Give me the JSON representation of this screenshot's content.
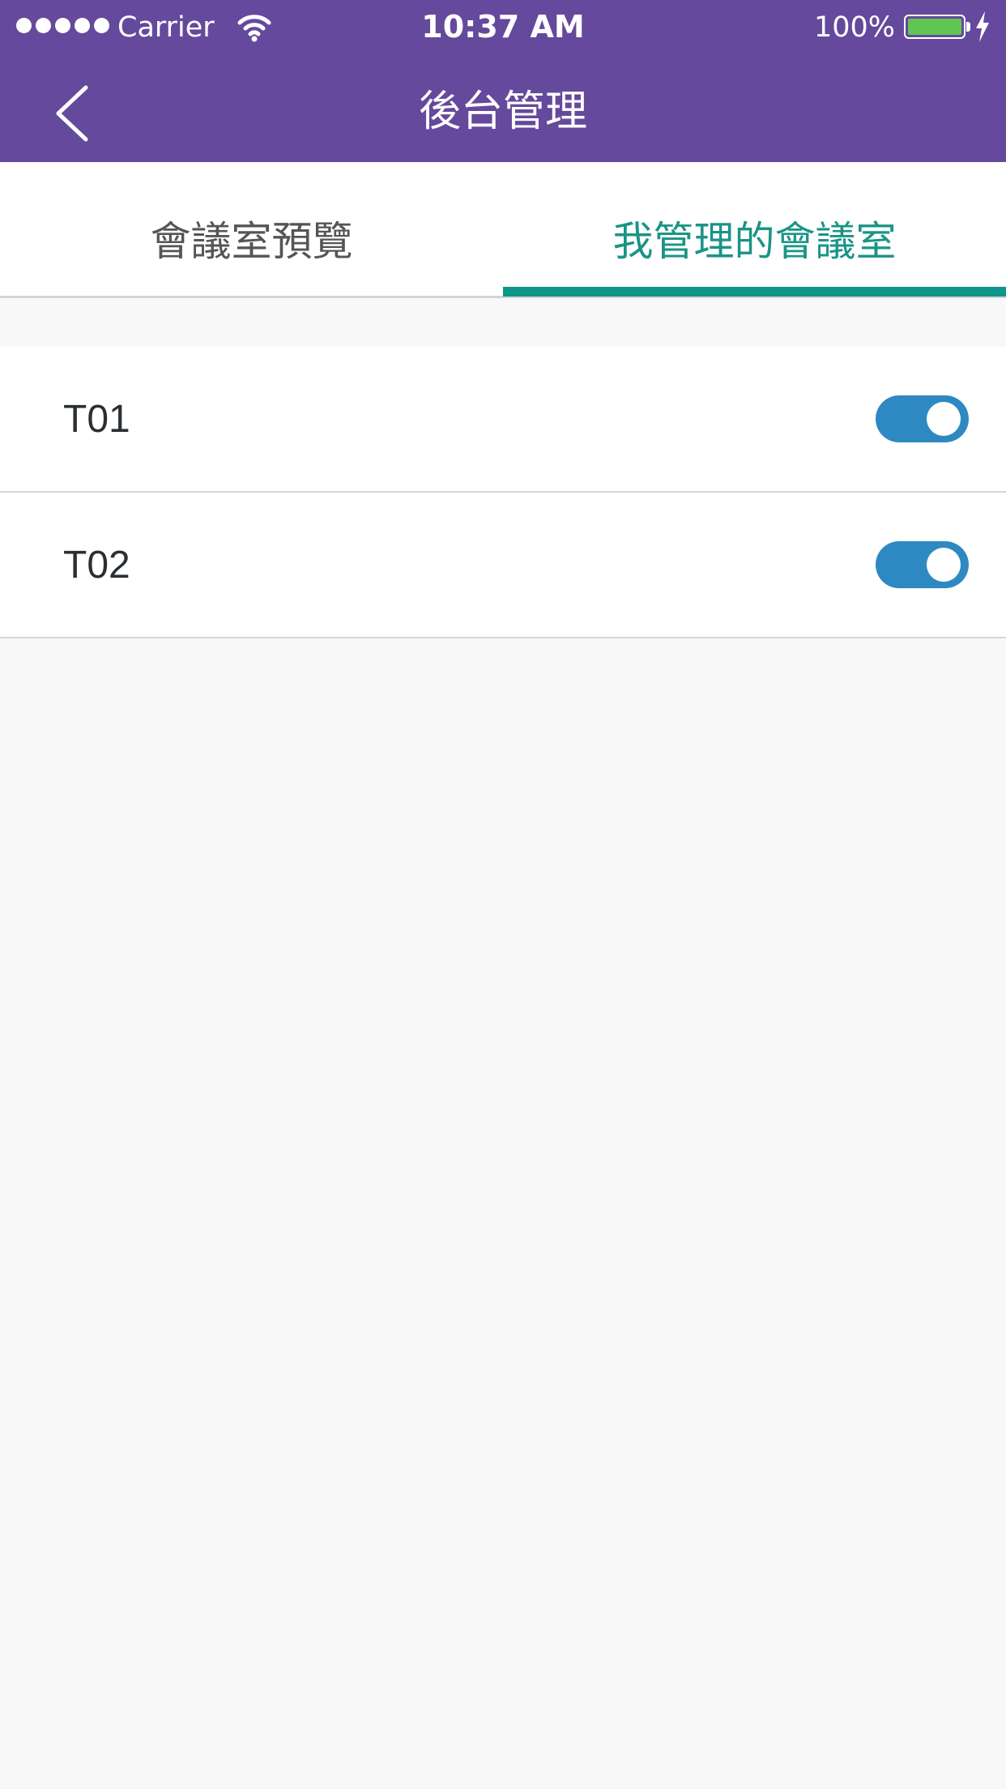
{
  "status_bar": {
    "carrier": "Carrier",
    "time": "10:37 AM",
    "battery_percent": "100%",
    "battery_level": 1.0,
    "signal_bars": 5,
    "battery_fill_color": "#61c554"
  },
  "nav": {
    "title": "後台管理",
    "back_icon": "chevron-left-icon",
    "background_color": "#65499c"
  },
  "tabs": {
    "items": [
      {
        "label": "會議室預覽",
        "active": false
      },
      {
        "label": "我管理的會議室",
        "active": true
      }
    ],
    "active_color": "#0e968a"
  },
  "rooms": [
    {
      "name": "T01",
      "enabled": true
    },
    {
      "name": "T02",
      "enabled": true
    }
  ],
  "colors": {
    "toggle_on": "#2e89c2",
    "background": "#f8f8f8"
  }
}
